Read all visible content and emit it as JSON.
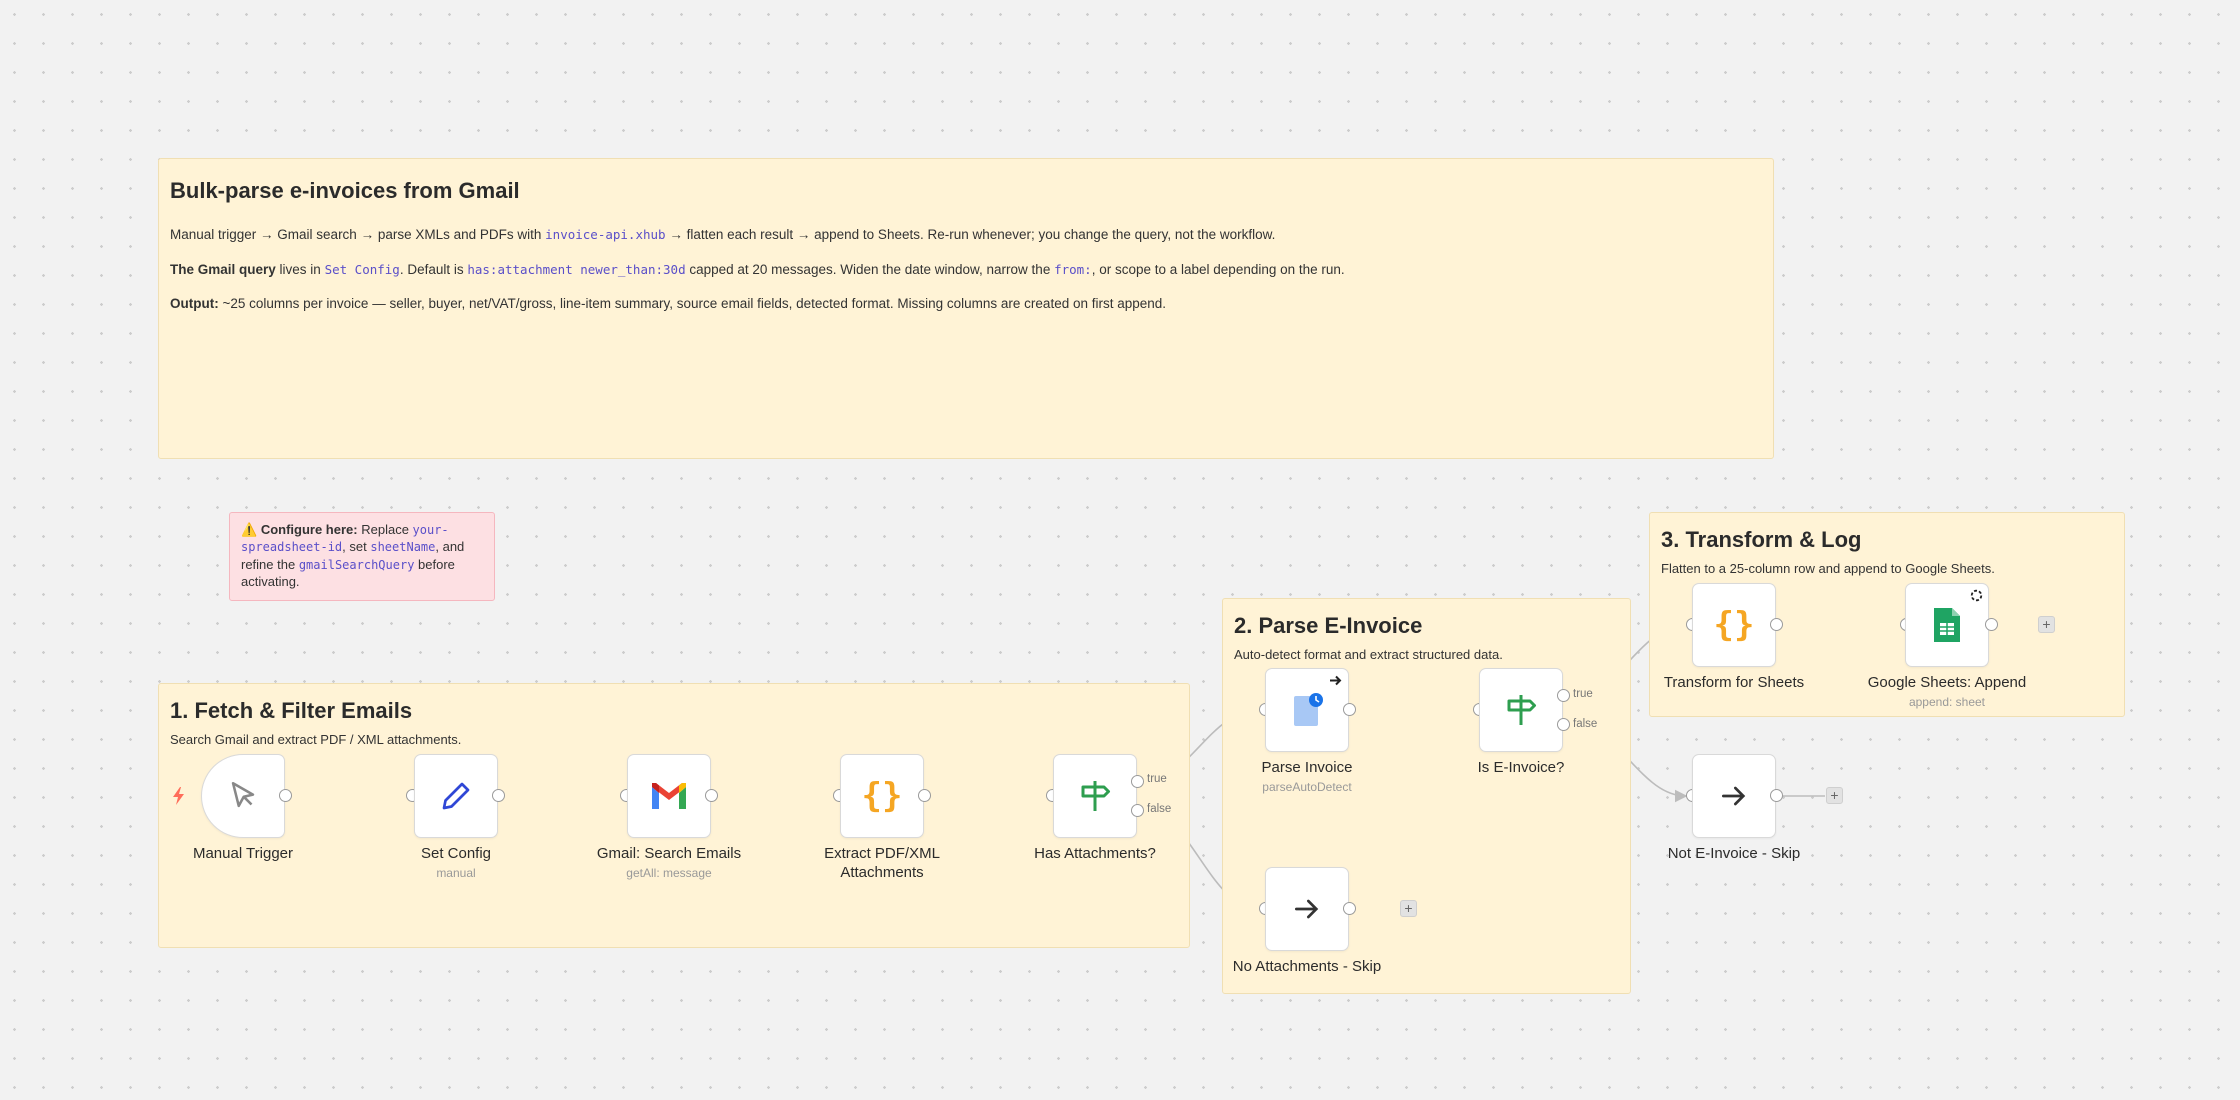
{
  "intro": {
    "title": "Bulk-parse e-invoices from Gmail",
    "line1": {
      "before": "Manual trigger → Gmail search → parse XMLs and PDFs with ",
      "code": "invoice-api.xhub",
      "after": " → flatten each result → append to Sheets. Re-run whenever; you change the query, not the workflow."
    },
    "line2": {
      "bold": "The Gmail query",
      "t1": " lives in ",
      "code1": "Set Config",
      "t2": ". Default is ",
      "code2": "has:attachment newer_than:30d",
      "t3": " capped at 20 messages. Widen the date window, narrow the ",
      "code3": "from:",
      "t4": ", or scope to a label depending on the run."
    },
    "line3": {
      "bold": "Output:",
      "text": " ~25 columns per invoice — seller, buyer, net/VAT/gross, line-item summary, source email fields, detected format. Missing columns are created on first append."
    }
  },
  "warning": {
    "icon": "⚠️",
    "bold": "Configure here:",
    "t1": " Replace ",
    "code1": "your-spreadsheet-id",
    "t2": ", set ",
    "code2": "sheetName",
    "t3": ", and refine the ",
    "code3": "gmailSearchQuery",
    "t4": " before activating."
  },
  "sections": {
    "fetch": {
      "title": "1. Fetch & Filter Emails",
      "desc": "Search Gmail and extract PDF / XML attachments."
    },
    "parse": {
      "title": "2. Parse E-Invoice",
      "desc": "Auto-detect format and extract structured data."
    },
    "transform": {
      "title": "3. Transform & Log",
      "desc": "Flatten to a 25-column row and append to Google Sheets."
    }
  },
  "nodes": {
    "manual_trigger": {
      "label": "Manual Trigger",
      "icon": "cursor-icon"
    },
    "set_config": {
      "label": "Set Config",
      "sub": "manual",
      "icon": "pencil-icon"
    },
    "gmail_search": {
      "label": "Gmail: Search Emails",
      "sub": "getAll: message",
      "icon": "gmail-icon"
    },
    "extract": {
      "label": "Extract PDF/XML Attachments",
      "icon": "braces-icon"
    },
    "has_attachments": {
      "label": "Has Attachments?",
      "icon": "signpost-icon",
      "true_label": "true",
      "false_label": "false"
    },
    "parse_invoice": {
      "label": "Parse Invoice",
      "sub": "parseAutoDetect",
      "icon": "document-icon"
    },
    "is_einvoice": {
      "label": "Is E-Invoice?",
      "icon": "signpost-icon",
      "true_label": "true",
      "false_label": "false"
    },
    "no_attach_skip": {
      "label": "No Attachments - Skip",
      "icon": "arrow-right-icon"
    },
    "transform_sheets": {
      "label": "Transform for Sheets",
      "icon": "braces-icon"
    },
    "sheets_append": {
      "label": "Google Sheets: Append",
      "sub": "append: sheet",
      "icon": "google-sheets-icon"
    },
    "not_einvoice_skip": {
      "label": "Not E-Invoice - Skip",
      "icon": "arrow-right-icon"
    }
  },
  "add_button": "+",
  "colors": {
    "sticky_bg": "#fff3d6",
    "warning_bg": "#fde0e3",
    "code": "#5a4fc9",
    "braces": "#f5a623",
    "signpost": "#2e9e4f",
    "pencil": "#2f47d6"
  }
}
